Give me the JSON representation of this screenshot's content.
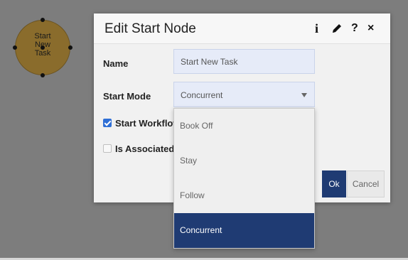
{
  "canvas": {
    "node": {
      "label": "Start\nNew\nTask"
    }
  },
  "dialog": {
    "title": "Edit Start Node",
    "icons": [
      "info-icon",
      "pencil-icon",
      "help-icon",
      "close-icon"
    ],
    "info_glyph": "i",
    "help_glyph": "?",
    "close_glyph": "×",
    "name": {
      "label": "Name",
      "value": "Start New Task"
    },
    "start_mode": {
      "label": "Start Mode",
      "value": "Concurrent"
    },
    "start_workflow": {
      "label": "Start Workflow",
      "checked": true
    },
    "is_associated": {
      "label": "Is Associated",
      "checked": false
    },
    "ok_label": "Ok",
    "cancel_label": "Cancel"
  },
  "dropdown": {
    "options": [
      "Book Off",
      "Stay",
      "Follow",
      "Concurrent"
    ],
    "selected": "Concurrent"
  },
  "colors": {
    "accent": "#1f3b73",
    "node_fill": "#8a6c2c",
    "backdrop": "#7d7d7d"
  }
}
